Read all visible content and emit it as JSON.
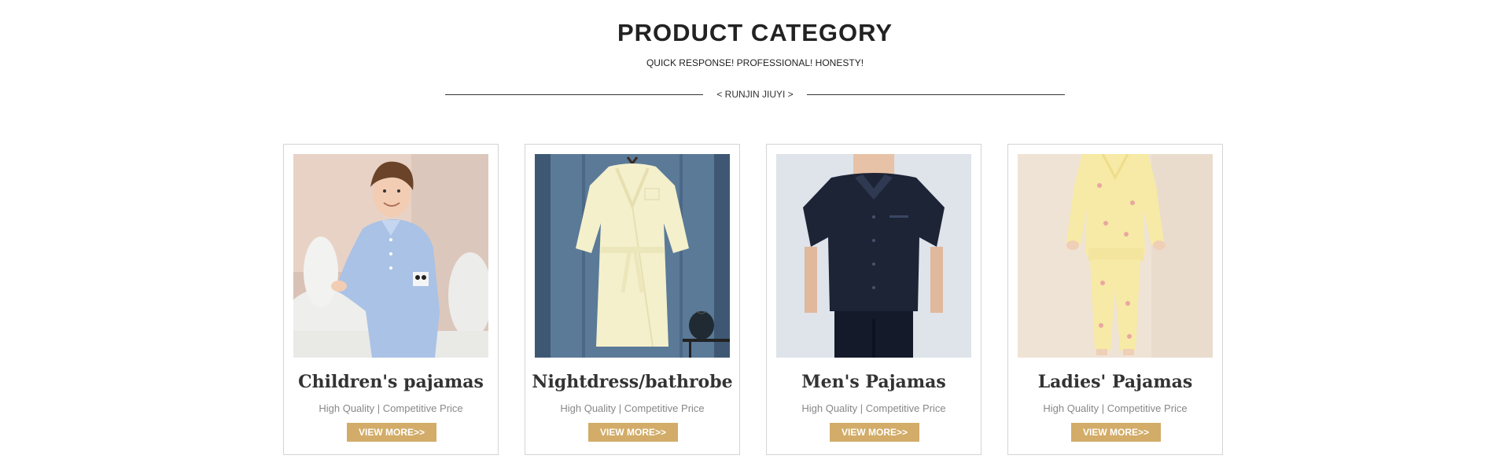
{
  "header": {
    "title": "PRODUCT CATEGORY",
    "subtitle": "QUICK RESPONSE! PROFESSIONAL! HONESTY!",
    "divider_text": "< RUNJIN JIUYI >"
  },
  "colors": {
    "button_bg": "#d2ac68",
    "card_border": "#d4d4d4"
  },
  "products": [
    {
      "name": "Children's pajamas",
      "tagline": "High Quality | Competitive Price",
      "button_label": "VIEW MORE>>",
      "image": "child-blue-pajamas-photo"
    },
    {
      "name": "Nightdress/bathrobe",
      "tagline": "High Quality | Competitive Price",
      "button_label": "VIEW MORE>>",
      "image": "cream-bathrobe-photo"
    },
    {
      "name": "Men's Pajamas",
      "tagline": "High Quality | Competitive Price",
      "button_label": "VIEW MORE>>",
      "image": "navy-mens-pajamas-photo"
    },
    {
      "name": "Ladies' Pajamas",
      "tagline": "High Quality | Competitive Price",
      "button_label": "VIEW MORE>>",
      "image": "yellow-ladies-pajamas-photo"
    }
  ]
}
